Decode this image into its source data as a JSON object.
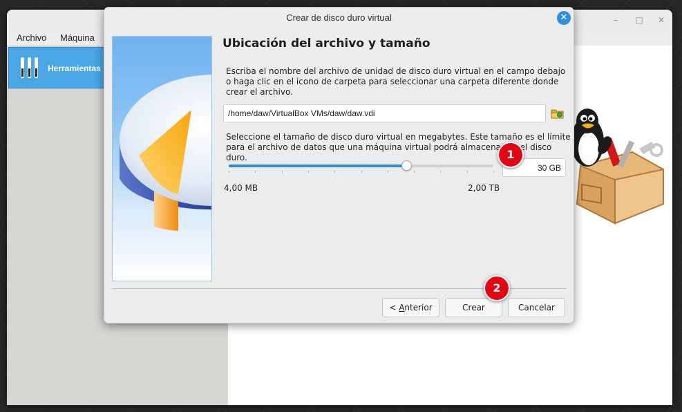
{
  "main_window": {
    "menu": [
      "Archivo",
      "Máquina"
    ],
    "tools_label": "Herramientas"
  },
  "dialog": {
    "title": "Crear de disco duro virtual",
    "heading": "Ubicación del archivo y tamaño",
    "location_description": "Escriba el nombre del archivo de unidad de disco duro virtual en el campo debajo o haga clic en el icono de carpeta para seleccionar una carpeta diferente donde crear el archivo.",
    "file_path": "/home/daw/VirtualBox VMs/daw/daw.vdi",
    "size_description": "Seleccione el tamaño de disco duro virtual en megabytes. Este tamaño es el límite para el archivo de datos que una máquina virtual podrá almacenar en el disco duro.",
    "size_value": "30 GB",
    "slider_position": 0.67,
    "min_label": "4,00 MB",
    "max_label": "2,00 TB",
    "buttons": {
      "back_prefix": "< ",
      "back_mnemonic": "A",
      "back_rest": "nterior",
      "create": "Crear",
      "cancel": "Cancelar"
    }
  },
  "annotations": [
    "1",
    "2"
  ],
  "colors": {
    "accent": "#2d8fd8",
    "badge": "#e30613",
    "tools_selected": "#4aa7e6"
  }
}
